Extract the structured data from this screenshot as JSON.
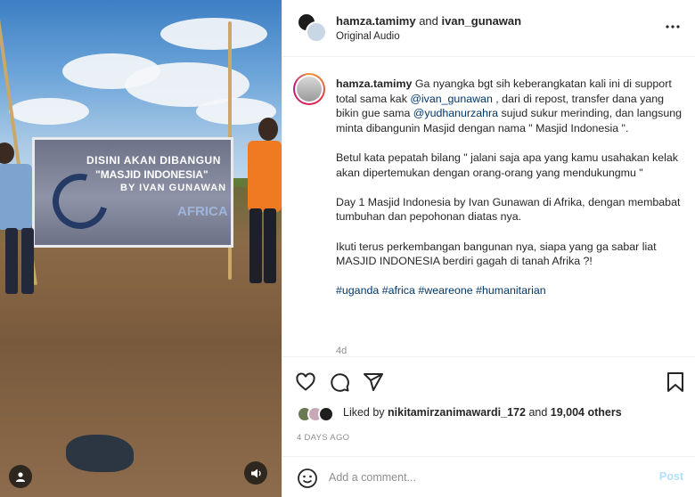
{
  "media": {
    "banner_line1": "DISINI AKAN DIBANGUN",
    "banner_line2": "\"MASJID INDONESIA\"",
    "banner_line3": "BY IVAN GUNAWAN",
    "banner_line4": "AFRICA"
  },
  "header": {
    "user1": "hamza.tamimy",
    "joiner": " and ",
    "user2": "ivan_gunawan",
    "audio": "Original Audio"
  },
  "caption": {
    "username": "hamza.tamimy",
    "p1_a": " Ga nyangka bgt sih keberangkatan kali ini di support total sama kak ",
    "mention1": "@ivan_gunawan",
    "p1_b": " , dari di repost, transfer dana yang bikin gue sama ",
    "mention2": "@yudhanurzahra",
    "p1_c": " sujud sukur merinding, dan langsung minta dibangunin Masjid dengan nama \" Masjid Indonesia \".",
    "p2": "Betul kata pepatah bilang \" jalani saja apa yang kamu usahakan kelak akan dipertemukan dengan orang-orang yang mendukungmu \"",
    "p3": "Day 1 Masjid Indonesia by Ivan Gunawan di Afrika, dengan membabat tumbuhan dan pepohonan diatas nya.",
    "p4": "Ikuti terus perkembangan bangunan nya, siapa yang ga sabar liat MASJID INDONESIA berdiri gagah di tanah Afrika ?!",
    "hashtags": [
      "#uganda",
      "#africa",
      "#weareone",
      "#humanitarian"
    ],
    "age": "4d"
  },
  "likes": {
    "prefix": "Liked by ",
    "user": "nikitamirzanimawardi_172",
    "and": " and ",
    "count": "19,004 others"
  },
  "date": "4 DAYS AGO",
  "comment": {
    "placeholder": "Add a comment...",
    "post": "Post"
  },
  "colors": {
    "link": "#00376b",
    "post_disabled": "#b2dffc",
    "muted": "#8e8e8e"
  }
}
